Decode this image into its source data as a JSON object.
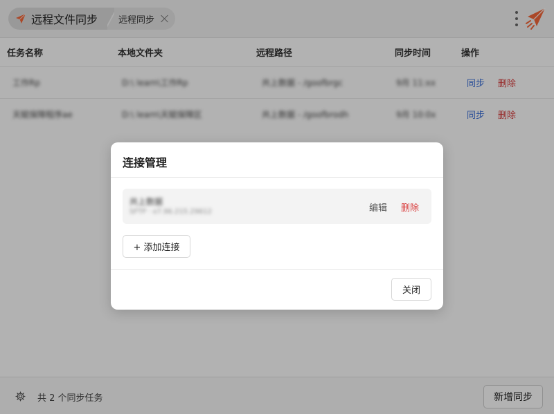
{
  "tabs": {
    "app_title": "远程文件同步",
    "sub_title": "远程同步"
  },
  "icons": {
    "app": "paper-plane-icon",
    "close_tab": "close-icon",
    "menu": "more-vertical-icon",
    "brand": "paper-plane-logo",
    "settings": "gear-icon"
  },
  "colors": {
    "brand": "#f5683a",
    "link": "#3a6fd8",
    "danger": "#d93c3c"
  },
  "table": {
    "columns": [
      "任务名称",
      "本地文件夹",
      "远程路径",
      "同步时间",
      "操作"
    ],
    "rows": [
      {
        "name": "工作Rp",
        "local": "D:\\ learn\\工作Rp",
        "remote": "共上数据 - /goofbrgc",
        "time": "9月 11:xx",
        "sync": "同步",
        "delete": "删除"
      },
      {
        "name": "天赋保障程序ae",
        "local": "D:\\ learn\\天赋保障区",
        "remote": "共上数据 - /goofbrodh",
        "time": "9月 10:0x",
        "sync": "同步",
        "delete": "删除"
      }
    ]
  },
  "footer": {
    "count_text": "共 2 个同步任务",
    "new_sync_label": "新增同步"
  },
  "modal": {
    "title": "连接管理",
    "connection": {
      "name": "共上数据",
      "detail": "SFTP · x7.96.215.29612",
      "edit_label": "编辑",
      "delete_label": "删除"
    },
    "add_label": "+ 添加连接",
    "close_label": "关闭"
  }
}
